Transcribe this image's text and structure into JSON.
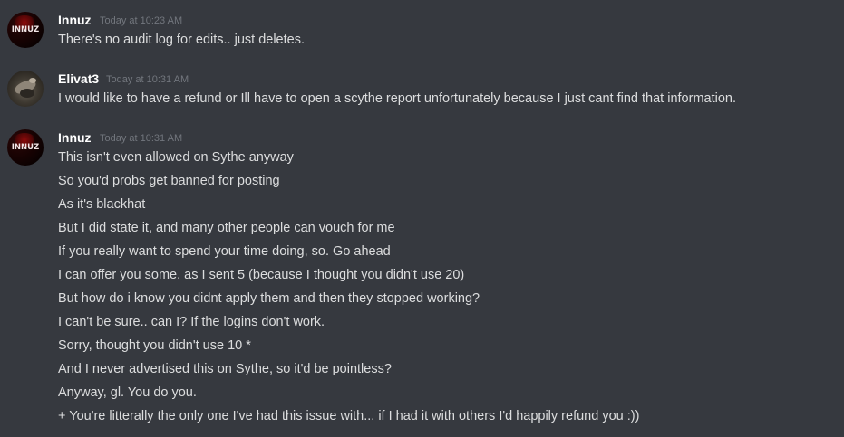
{
  "messages": [
    {
      "username": "Innuz",
      "avatar_icon": "innuz-avatar-icon",
      "avatar_text": "INNUZ",
      "timestamp": "Today at 10:23 AM",
      "lines": [
        "There's no audit log for edits.. just deletes."
      ]
    },
    {
      "username": "Elivat3",
      "avatar_icon": "elivat3-avatar-icon",
      "timestamp": "Today at 10:31 AM",
      "lines": [
        "I would like to have a refund or Ill have to open a scythe report unfortunately because I just cant find that information."
      ]
    },
    {
      "username": "Innuz",
      "avatar_icon": "innuz-avatar-icon",
      "avatar_text": "INNUZ",
      "timestamp": "Today at 10:31 AM",
      "lines": [
        "This isn't even allowed on Sythe anyway",
        "So you'd probs get banned for posting",
        "As it's blackhat",
        "But I did state it, and many other people can vouch for me",
        "If you really want to spend your time doing, so. Go ahead",
        "I can offer you some, as I sent 5 (because I thought you didn't use 20)",
        "But how do i know you didnt apply them and then they stopped working?",
        "I can't be sure.. can I? If the logins don't work.",
        "Sorry, thought you didn't use 10 *",
        "And I never advertised this on Sythe, so it'd be pointless?",
        "Anyway, gl. You do you.",
        "+ You're litterally the only one I've had this issue with... if I had it with others I'd happily refund you :))"
      ]
    }
  ]
}
